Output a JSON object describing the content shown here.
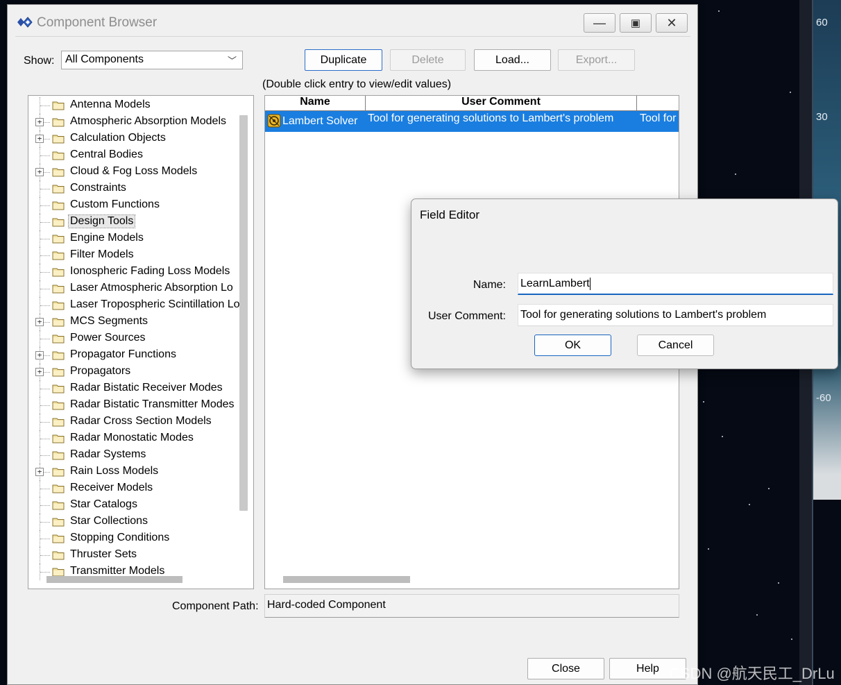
{
  "window": {
    "title": "Component Browser"
  },
  "toolbar": {
    "show_label": "Show:",
    "show_value": "All Components",
    "duplicate": "Duplicate",
    "delete": "Delete",
    "load": "Load...",
    "export": "Export..."
  },
  "hint": "(Double click entry to view/edit values)",
  "tree": {
    "items": [
      {
        "label": "Antenna Models",
        "expandable": false
      },
      {
        "label": "Atmospheric Absorption Models",
        "expandable": true
      },
      {
        "label": "Calculation Objects",
        "expandable": true
      },
      {
        "label": "Central Bodies",
        "expandable": false
      },
      {
        "label": "Cloud & Fog Loss Models",
        "expandable": true
      },
      {
        "label": "Constraints",
        "expandable": false
      },
      {
        "label": "Custom Functions",
        "expandable": false
      },
      {
        "label": "Design Tools",
        "expandable": false,
        "selected": true
      },
      {
        "label": "Engine Models",
        "expandable": false
      },
      {
        "label": "Filter Models",
        "expandable": false
      },
      {
        "label": "Ionospheric Fading Loss Models",
        "expandable": false
      },
      {
        "label": "Laser Atmospheric Absorption Lo",
        "expandable": false
      },
      {
        "label": "Laser Tropospheric Scintillation Lo",
        "expandable": false
      },
      {
        "label": "MCS Segments",
        "expandable": true
      },
      {
        "label": "Power Sources",
        "expandable": false
      },
      {
        "label": "Propagator Functions",
        "expandable": true
      },
      {
        "label": "Propagators",
        "expandable": true
      },
      {
        "label": "Radar Bistatic Receiver Modes",
        "expandable": false
      },
      {
        "label": "Radar Bistatic Transmitter Modes",
        "expandable": false
      },
      {
        "label": "Radar Cross Section Models",
        "expandable": false
      },
      {
        "label": "Radar Monostatic Modes",
        "expandable": false
      },
      {
        "label": "Radar Systems",
        "expandable": false
      },
      {
        "label": "Rain Loss Models",
        "expandable": true
      },
      {
        "label": "Receiver Models",
        "expandable": false
      },
      {
        "label": "Star Catalogs",
        "expandable": false
      },
      {
        "label": "Star Collections",
        "expandable": false
      },
      {
        "label": "Stopping Conditions",
        "expandable": false
      },
      {
        "label": "Thruster Sets",
        "expandable": false
      },
      {
        "label": "Transmitter Models",
        "expandable": false
      }
    ]
  },
  "list": {
    "columns": [
      "Name",
      "User Comment",
      ""
    ],
    "rows": [
      {
        "name": "Lambert Solver",
        "comment": "Tool for generating solutions to Lambert's problem",
        "extra": "Tool for g"
      }
    ]
  },
  "component_path": {
    "label": "Component Path:",
    "value": "Hard-coded Component"
  },
  "footer": {
    "close": "Close",
    "help": "Help"
  },
  "field_editor": {
    "title": "Field Editor",
    "name_label": "Name:",
    "name_value": "LearnLambert",
    "comment_label": "User Comment:",
    "comment_value": "Tool for generating solutions to Lambert's problem",
    "ok": "OK",
    "cancel": "Cancel"
  },
  "background": {
    "scale_labels": [
      "60",
      "30",
      "-60"
    ]
  },
  "watermark": "CSDN @航天民工_DrLu",
  "colors": {
    "selection": "#1a7ee0",
    "focus": "#1665c0",
    "space": "#050a14"
  }
}
